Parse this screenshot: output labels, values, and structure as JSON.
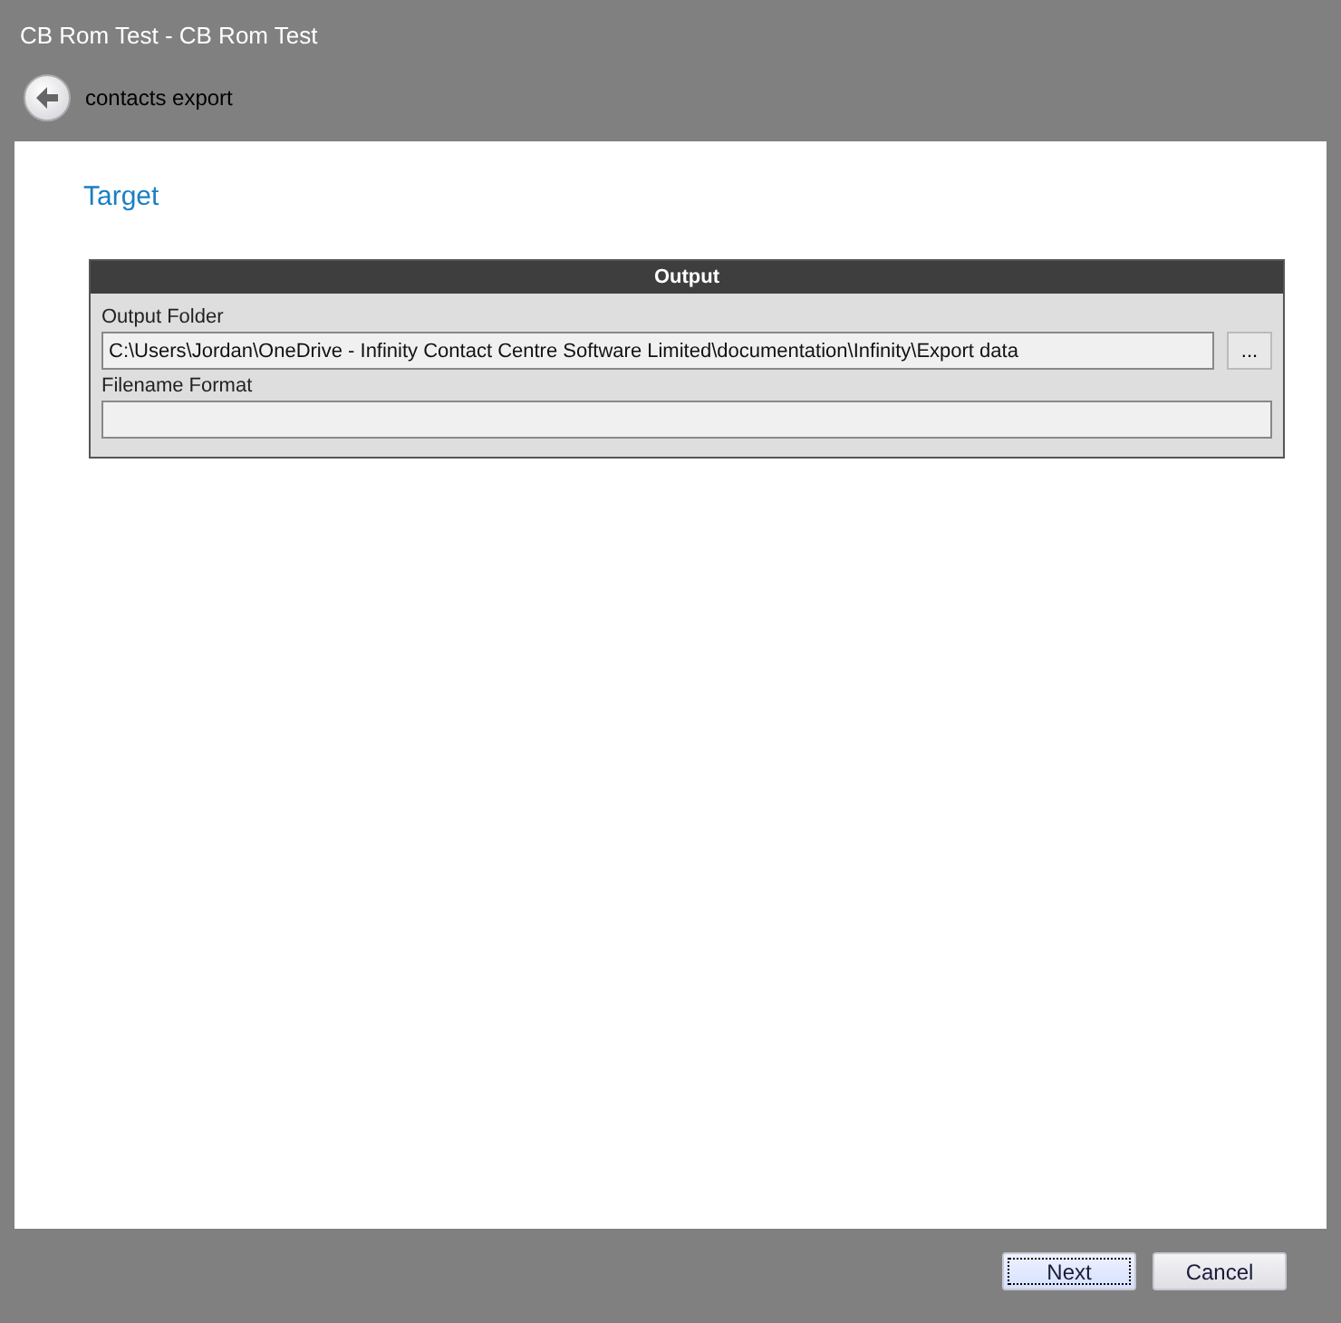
{
  "window": {
    "title": "CB Rom Test - CB Rom Test"
  },
  "header": {
    "title": "contacts export"
  },
  "page": {
    "heading": "Target"
  },
  "group": {
    "title": "Output",
    "fields": [
      {
        "label": "Output Folder",
        "value": "C:\\Users\\Jordan\\OneDrive - Infinity Contact Centre Software Limited\\documentation\\Infinity\\Export data",
        "browse": "..."
      },
      {
        "label": "Filename Format"
      }
    ]
  },
  "buttons": [
    {
      "label": "Next",
      "focused": true
    },
    {
      "label": "Cancel",
      "focused": false
    }
  ]
}
